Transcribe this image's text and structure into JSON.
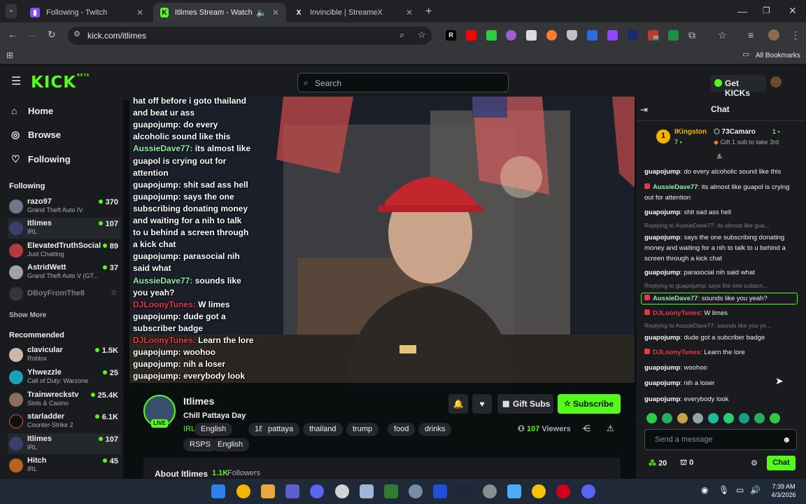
{
  "browser": {
    "tabs": [
      {
        "title": "Following - Twitch",
        "close": "✕"
      },
      {
        "title": "Itlimes Stream - Watch Live",
        "close": "✕"
      },
      {
        "title": "Invincible | StreameX",
        "close": "✕"
      }
    ],
    "new_tab": "+",
    "url": "kick.com/itlimes",
    "bookmarks_label": "All Bookmarks",
    "ext_badge": "39"
  },
  "kick": {
    "logo": "KICK",
    "logo_badge": "BETA",
    "search_placeholder": "Search",
    "get_kicks": "Get KICKs"
  },
  "sidebar": {
    "nav": [
      {
        "label": "Home",
        "icon": "home-icon"
      },
      {
        "label": "Browse",
        "icon": "compass-icon"
      },
      {
        "label": "Following",
        "icon": "heart-icon"
      }
    ],
    "following_title": "Following",
    "following": [
      {
        "name": "razo97",
        "game": "Grand Theft Auto IV",
        "viewers": "370"
      },
      {
        "name": "Itlimes",
        "game": "IRL",
        "viewers": "107"
      },
      {
        "name": "ElevatedTruthSocial",
        "game": "Just Chatting",
        "viewers": "89"
      },
      {
        "name": "AstridWett",
        "game": "Grand Theft Auto V (GT...",
        "viewers": "37"
      },
      {
        "name": "DBoyFromThe8",
        "game": "",
        "viewers": ""
      }
    ],
    "show_more": "Show More",
    "recommended_title": "Recommended",
    "recommended": [
      {
        "name": "clavicular",
        "game": "Roblox",
        "viewers": "1.5K"
      },
      {
        "name": "Yhwezzle",
        "game": "Call of Duty: Warzone",
        "viewers": "25"
      },
      {
        "name": "Trainwreckstv",
        "game": "Slots & Casino",
        "viewers": "25.4K"
      },
      {
        "name": "starladder",
        "game": "Counter-Strike 2",
        "viewers": "6.1K"
      },
      {
        "name": "Itlimes",
        "game": "IRL",
        "viewers": "107"
      },
      {
        "name": "Hitch",
        "game": "IRL",
        "viewers": "45"
      }
    ]
  },
  "overlay": [
    {
      "user": "",
      "text": "hat off before i goto thailand"
    },
    {
      "user": "",
      "text": "and beat ur ass"
    },
    {
      "user": "guapojump:",
      "text": " do every"
    },
    {
      "user": "",
      "text": "alcoholic sound like this"
    },
    {
      "user": "AussieDave77:",
      "text": " its almost like"
    },
    {
      "user": "",
      "text": "guapol is crying out for"
    },
    {
      "user": "",
      "text": "attention"
    },
    {
      "user": "guapojump:",
      "text": " shit sad ass hell"
    },
    {
      "user": "guapojump:",
      "text": " says the one"
    },
    {
      "user": "",
      "text": "subscribing donating money"
    },
    {
      "user": "",
      "text": "and waiting for a nih to talk"
    },
    {
      "user": "",
      "text": "to u behind a screen through"
    },
    {
      "user": "",
      "text": "a kick chat"
    },
    {
      "user": "guapojump:",
      "text": " parasocial nih"
    },
    {
      "user": "",
      "text": "said what"
    },
    {
      "user": "AussieDave77:",
      "text": " sounds like"
    },
    {
      "user": "",
      "text": "you yeah?"
    },
    {
      "user": "DJLoonyTunes:",
      "text": " W limes"
    },
    {
      "user": "guapojump:",
      "text": " dude got a"
    },
    {
      "user": "",
      "text": "subscriber badge"
    },
    {
      "user": "DJLoonyTunes:",
      "text": " Learn the lore"
    },
    {
      "user": "guapojump:",
      "text": " woohoo"
    },
    {
      "user": "guapojump:",
      "text": " nih a loser"
    },
    {
      "user": "guapojump:",
      "text": " everybody look"
    }
  ],
  "stream": {
    "channel": "Itlimes",
    "title": "Chill Pattaya Day",
    "live": "LIVE",
    "category": "IRL",
    "tags": [
      "English",
      "18",
      "pattaya",
      "thailand",
      "trump",
      "food",
      "drinks"
    ],
    "tags2": [
      "RSPS",
      "English"
    ],
    "gift_subs": "Gift Subs",
    "subscribe": "Subscribe",
    "viewers": "107",
    "viewers_label": "Viewers",
    "about": "About Itlimes",
    "followers": "1.1K",
    "followers_label": "Followers"
  },
  "chat": {
    "title": "Chat",
    "leaderboard": [
      {
        "rank": "1",
        "name": "IKingston",
        "count": "7"
      },
      {
        "name": "73Camaro",
        "count": "1"
      }
    ],
    "gift_promo": "Gift 1 sub to take 3rd",
    "messages": [
      {
        "reply": "",
        "user": "guapojump",
        "text": "do every alcoholic sound like this",
        "badge": false
      },
      {
        "reply": "",
        "user": "AussieDave77",
        "text": "its almost like guapol is crying out for attention",
        "badge": true
      },
      {
        "reply": "",
        "user": "guapojump",
        "text": "shit sad ass hell",
        "badge": false
      },
      {
        "reply": "Replying to AussieDave77: its almost like gua...",
        "user": "guapojump",
        "text": "says the one subscribing donating money and waiting for a nih to talk to u behind a screen through a kick chat",
        "badge": false
      },
      {
        "reply": "",
        "user": "guapojump",
        "text": "parasocial nih said what",
        "badge": false
      },
      {
        "reply": "Replying to guapojump: says the one subscri...",
        "user": "AussieDave77",
        "text": "sounds like you yeah?",
        "badge": true
      },
      {
        "reply": "",
        "user": "DJLoonyTunes",
        "text": "W limes",
        "badge": true
      },
      {
        "reply": "Replying to AussieDave77: sounds like you ye...",
        "user": "guapojump",
        "text": "dude got a subcriber badge",
        "badge": false
      },
      {
        "reply": "",
        "user": "DJLoonyTunes",
        "text": "Learn the lore",
        "badge": true
      },
      {
        "reply": "",
        "user": "guapojump",
        "text": "woohoo",
        "badge": false
      },
      {
        "reply": "",
        "user": "guapojump",
        "text": "nih a loser",
        "badge": false
      },
      {
        "reply": "",
        "user": "guapojump",
        "text": "everybody look",
        "badge": false
      }
    ],
    "input_placeholder": "Send a message",
    "points": "20",
    "kicks": "0",
    "send_label": "Chat"
  },
  "taskbar": {
    "time": "7:39 AM",
    "date": "4/3/2026"
  },
  "colors": {
    "kick_green": "#53fc18",
    "bg": "#0b0e0f",
    "panel": "#191b1f",
    "guapo": "#ffffff",
    "aussie": "#8ef0a8",
    "dj": "#e63946"
  }
}
